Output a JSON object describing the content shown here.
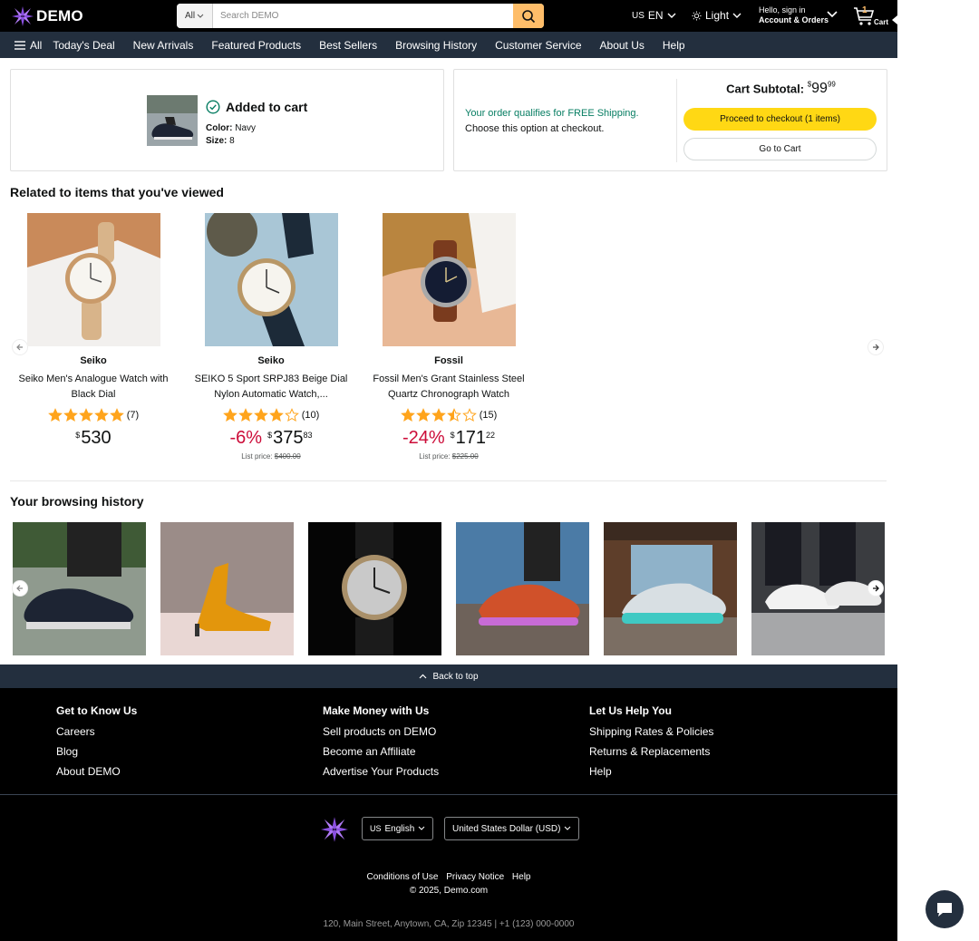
{
  "header": {
    "logo_text": "DEMO",
    "search": {
      "category": "All",
      "placeholder": "Search DEMO"
    },
    "language": {
      "flag": "US",
      "code": "EN"
    },
    "theme": "Light",
    "account": {
      "line1": "Hello, sign in",
      "line2": "Account & Orders"
    },
    "cart": {
      "count": "1",
      "label": "Cart"
    }
  },
  "nav": {
    "all": "All",
    "items": [
      "Today's Deal",
      "New Arrivals",
      "Featured Products",
      "Best Sellers",
      "Browsing History",
      "Customer Service",
      "About Us",
      "Help"
    ]
  },
  "added": {
    "title": "Added to cart",
    "color_label": "Color:",
    "color_value": "Navy",
    "size_label": "Size:",
    "size_value": "8"
  },
  "shipping": {
    "free": "Your order qualifies for FREE Shipping.",
    "choose": "Choose this option at checkout.",
    "subtotal_label": "Cart Subtotal:",
    "subtotal_currency": "$",
    "subtotal_whole": "99",
    "subtotal_cents": "99",
    "checkout_button": "Proceed to checkout (1 items)",
    "cart_button": "Go to Cart"
  },
  "related": {
    "title": "Related to items that you've viewed",
    "products": [
      {
        "brand": "Seiko",
        "name": "Seiko Men's Analogue Watch with Black Dial",
        "rating": 5,
        "reviews": "(7)",
        "discount": "",
        "currency": "$",
        "whole": "530",
        "cents": "",
        "list_label": "",
        "list_price": ""
      },
      {
        "brand": "Seiko",
        "name": "SEIKO 5 Sport SRPJ83 Beige Dial Nylon Automatic Watch,...",
        "rating": 4,
        "reviews": "(10)",
        "discount": "-6%",
        "currency": "$",
        "whole": "375",
        "cents": "83",
        "list_label": "List price:",
        "list_price": "$400.00"
      },
      {
        "brand": "Fossil",
        "name": "Fossil Men's Grant Stainless Steel Quartz Chronograph Watch",
        "rating": 3.5,
        "reviews": "(15)",
        "discount": "-24%",
        "currency": "$",
        "whole": "171",
        "cents": "22",
        "list_label": "List price:",
        "list_price": "$225.00"
      }
    ]
  },
  "history": {
    "title": "Your browsing history",
    "items": [
      "navy-sneaker",
      "gold-stiletto",
      "black-watch",
      "colorful-sneaker",
      "glow-sneaker",
      "white-sneaker"
    ]
  },
  "back_to_top": "Back to top",
  "footer": {
    "columns": [
      {
        "heading": "Get to Know Us",
        "links": [
          "Careers",
          "Blog",
          "About DEMO"
        ]
      },
      {
        "heading": "Make Money with Us",
        "links": [
          "Sell products on DEMO",
          "Become an Affiliate",
          "Advertise Your Products"
        ]
      },
      {
        "heading": "Let Us Help You",
        "links": [
          "Shipping Rates & Policies",
          "Returns & Replacements",
          "Help"
        ]
      }
    ],
    "language": {
      "flag": "US",
      "label": "English"
    },
    "currency": "United States Dollar (USD)",
    "links": [
      "Conditions of Use",
      "Privacy Notice",
      "Help"
    ],
    "copyright": "© 2025, Demo.com",
    "address": "120, Main Street, Anytown, CA, Zip 12345 | +1 (123) 000-0000"
  },
  "colors": {
    "accent": "#febd69",
    "checkout": "#ffd814",
    "nav": "#232f3e",
    "discount": "#cc0c39",
    "star": "#ffa41c",
    "free_shipping": "#067d62"
  }
}
